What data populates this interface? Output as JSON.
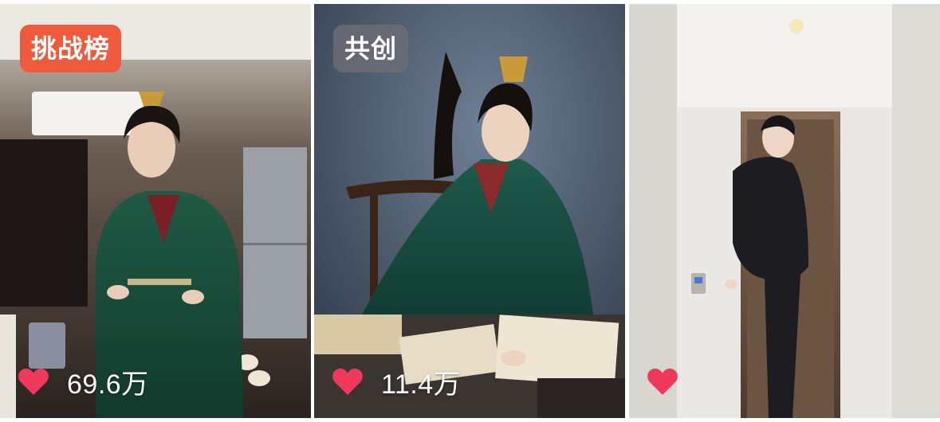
{
  "feed": {
    "cards": [
      {
        "badge": "挑战榜",
        "like_count": "69.6万",
        "heart_icon": "heart-icon",
        "colors": {
          "badge_bg": "#f05a3c",
          "heart": "#f0385a"
        }
      },
      {
        "badge": "共创",
        "like_count": "11.4万",
        "heart_icon": "heart-icon",
        "colors": {
          "badge_bg": "#6e6e76",
          "heart": "#f0385a"
        }
      },
      {
        "badge": "",
        "like_count": "",
        "heart_icon": "heart-icon",
        "colors": {
          "heart": "#f0385a"
        }
      }
    ]
  }
}
